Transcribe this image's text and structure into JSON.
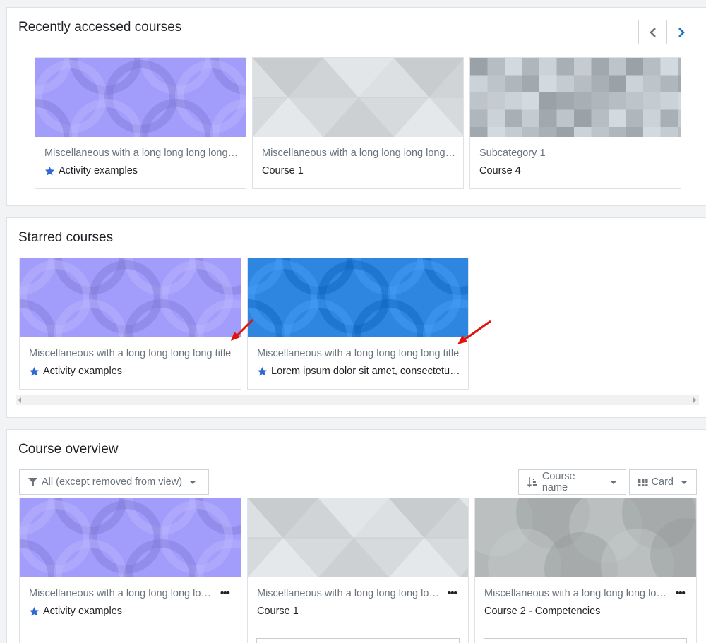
{
  "recent": {
    "title": "Recently accessed courses",
    "prev_icon": "chevron-left-icon",
    "next_icon": "chevron-right-icon",
    "courses": [
      {
        "category": "Miscellaneous with a long long long long title",
        "name": "Activity examples",
        "starred": true,
        "pattern": "circles",
        "color": "#a29dfa"
      },
      {
        "category": "Miscellaneous with a long long long long title",
        "name": "Course 1",
        "starred": false,
        "pattern": "triangles",
        "color": "#d6dadd"
      },
      {
        "category": "Subcategory 1",
        "name": "Course 4",
        "starred": false,
        "pattern": "squares",
        "color": "#b7bec3"
      }
    ]
  },
  "starred": {
    "title": "Starred courses",
    "courses": [
      {
        "category": "Miscellaneous with a long long long long title",
        "name": "Activity examples",
        "starred": true,
        "pattern": "circles",
        "color": "#a29dfa"
      },
      {
        "category": "Miscellaneous with a long long long long title",
        "name": "Lorem ipsum dolor sit amet, consectetur adipiscing elit",
        "starred": true,
        "pattern": "circles",
        "color": "#2e86e0"
      }
    ]
  },
  "overview": {
    "title": "Course overview",
    "filter_label": "All (except removed from view)",
    "sort_label": "Course name",
    "view_label": "Card",
    "courses": [
      {
        "category": "Miscellaneous with a long long long long title",
        "name": "Activity examples",
        "starred": true,
        "menu": "•••",
        "pattern": "circles",
        "color": "#a29dfa"
      },
      {
        "category": "Miscellaneous with a long long long long title",
        "name": "Course 1",
        "starred": false,
        "menu": "•••",
        "pattern": "triangles",
        "color": "#d6dadd"
      },
      {
        "category": "Miscellaneous with a long long long long title",
        "name": "Course 2 - Competencies",
        "starred": false,
        "menu": "•••",
        "pattern": "bigcircles",
        "color": "#b3b7b8"
      }
    ]
  },
  "colors": {
    "star": "#2f6ad0",
    "annotation_arrow": "#e3120b",
    "page_bg": "#f2f3f4",
    "link": "#1d6fc2"
  }
}
